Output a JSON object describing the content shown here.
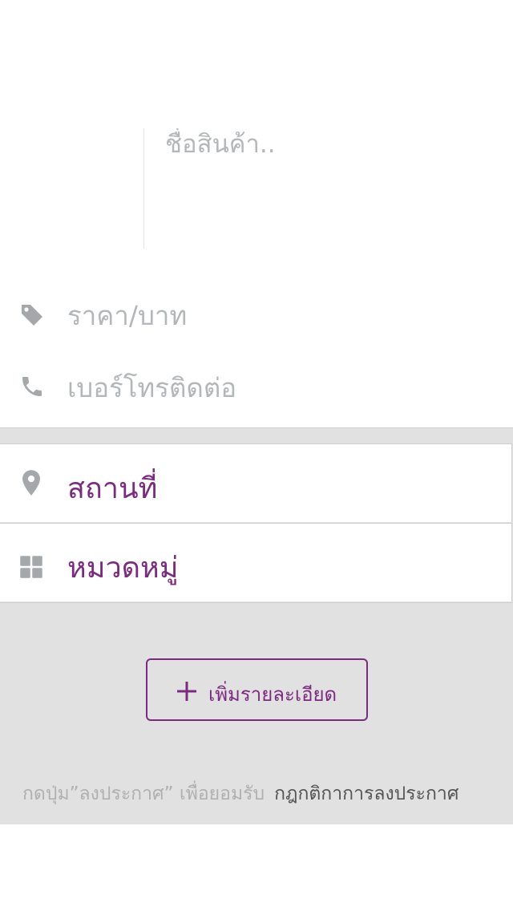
{
  "form": {
    "title_placeholder": "ชื่อสินค้า..",
    "price_placeholder": "ราคา/บาท",
    "phone_placeholder": "เบอร์โทรติดต่อ",
    "location_label": "สถานที่",
    "category_label": "หมวดหมู่",
    "add_detail_label": "เพิ่มรายละเอียด"
  },
  "terms": {
    "prefix": "กดปุ่ม”ลงประกาศ” เพื่อยอมรับ",
    "link": "กฎกติกาการลงประกาศ"
  },
  "icons": {
    "price": "tag-icon",
    "phone": "phone-icon",
    "location": "map-pin-icon",
    "category": "grid-icon",
    "add": "plus-icon"
  },
  "colors": {
    "accent": "#7b2a7f",
    "icon_gray": "#a4a8aa",
    "placeholder": "#b4b7b9",
    "background_gray": "#e1e1e1"
  }
}
